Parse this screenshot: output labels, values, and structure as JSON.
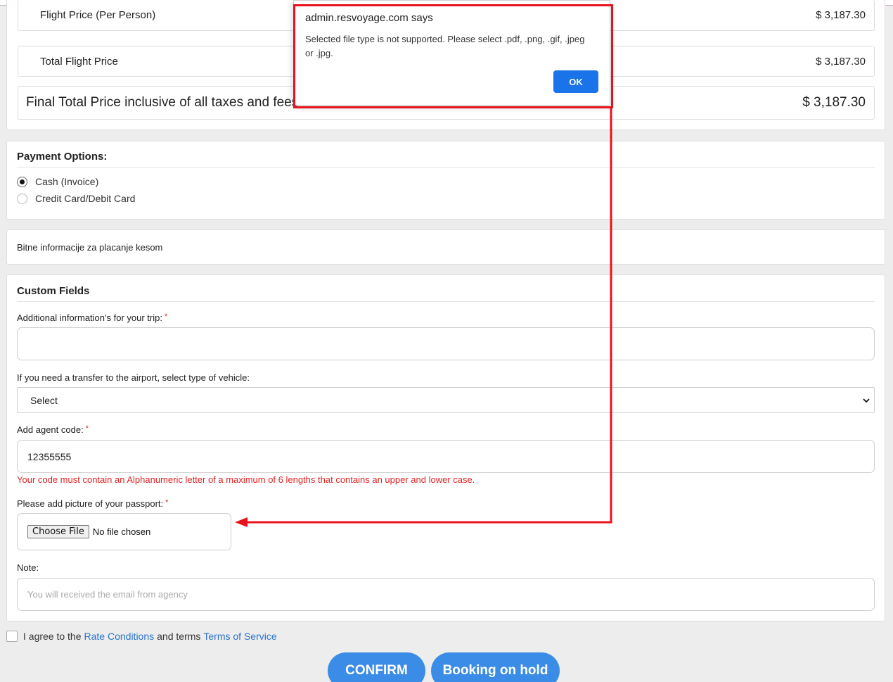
{
  "summary": {
    "rows": [
      {
        "label": "Flight Price (Per Person)",
        "amount": "$ 3,187.30"
      },
      {
        "label": "Total Flight Price",
        "amount": "$ 3,187.30"
      },
      {
        "label": "Final Total Price inclusive of all taxes and fees",
        "amount": "$ 3,187.30"
      }
    ]
  },
  "payment": {
    "title": "Payment Options:",
    "options": [
      {
        "label": "Cash (Invoice)",
        "selected": true
      },
      {
        "label": "Credit Card/Debit Card",
        "selected": false
      }
    ]
  },
  "info": {
    "text": "Bitne informacije za placanje kesom"
  },
  "custom_fields": {
    "title": "Custom Fields",
    "required_mark": "*",
    "trip_info": {
      "label": "Additional information's for your trip:",
      "value": ""
    },
    "transfer": {
      "label": "If you need a transfer to the airport, select type of vehicle:",
      "selected": "Select"
    },
    "agent_code": {
      "label": "Add agent code:",
      "value": "12355555",
      "error": "Your code must contain an Alphanumeric letter of a maximum of 6 lengths that contains an upper and lower case."
    },
    "passport": {
      "label": "Please add picture of your passport:",
      "button": "Choose File",
      "status": "No file chosen"
    },
    "note": {
      "label": "Note:",
      "placeholder": "You will received the email from agency"
    }
  },
  "agreement": {
    "prefix": "I agree to the",
    "link1": "Rate Conditions",
    "middle": "and terms",
    "link2": "Terms of Service"
  },
  "actions": {
    "confirm": "CONFIRM",
    "hold": "Booking on hold"
  },
  "dialog": {
    "origin": "admin.resvoyage.com says",
    "message": "Selected file type is not supported. Please select .pdf, .png, .gif, .jpeg or .jpg.",
    "ok": "OK"
  },
  "colors": {
    "accent": "#3b8ce6",
    "error": "#e02424",
    "annotation": "#e8121d",
    "link": "#2a72c9"
  }
}
